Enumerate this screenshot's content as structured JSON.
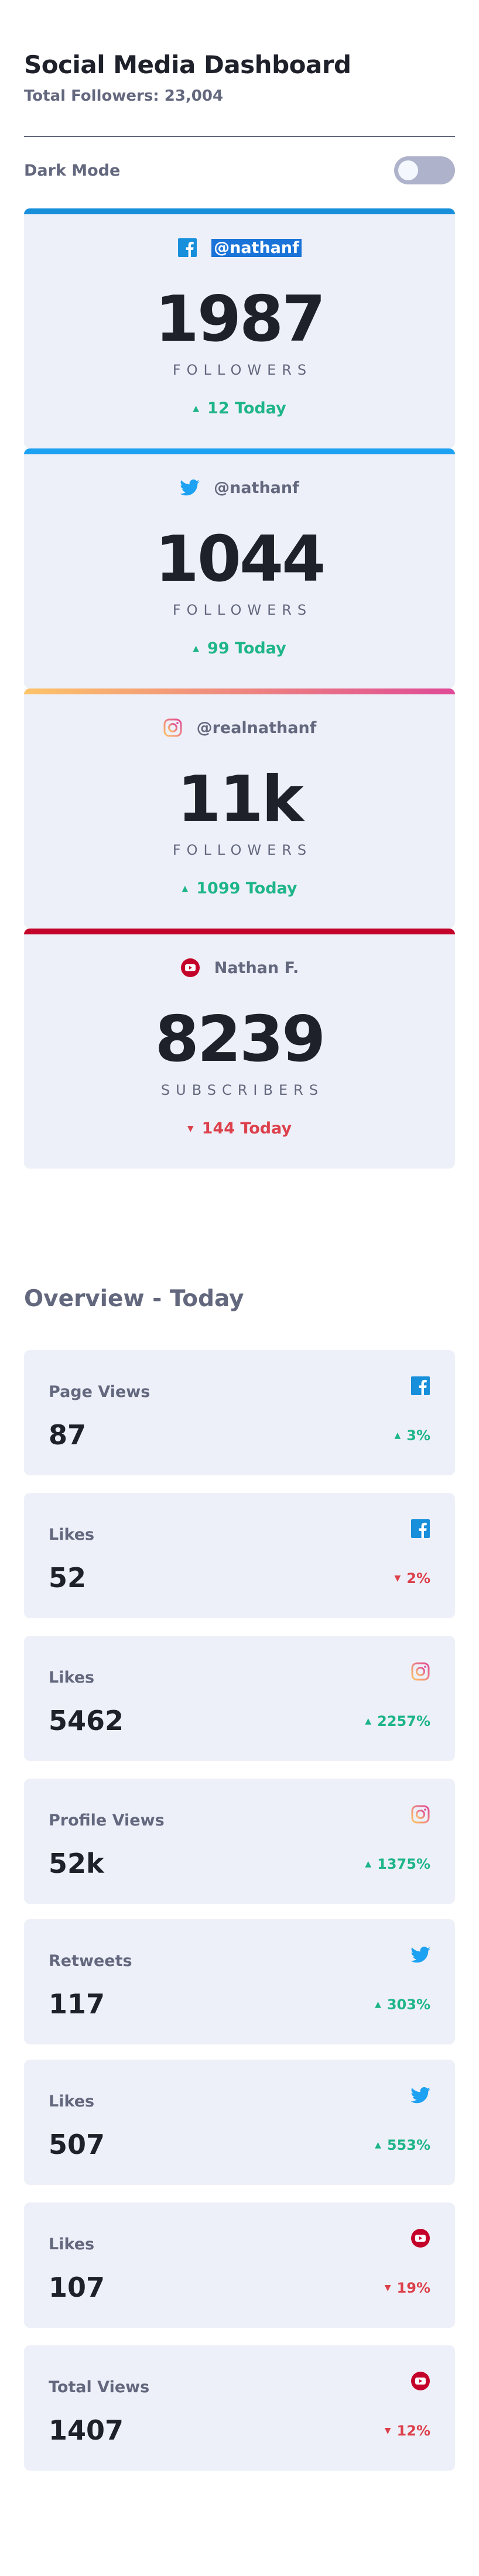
{
  "header": {
    "title": "Social Media Dashboard",
    "total_followers": "Total Followers: 23,004"
  },
  "dark_mode": {
    "label": "Dark Mode",
    "enabled": false
  },
  "follower_cards": [
    {
      "network": "facebook",
      "icon": "facebook-icon",
      "handle": "@nathanf",
      "count": "1987",
      "unit": "FOLLOWERS",
      "today": "12 Today",
      "trend": "up"
    },
    {
      "network": "twitter",
      "icon": "twitter-icon",
      "handle": "@nathanf",
      "count": "1044",
      "unit": "FOLLOWERS",
      "today": "99 Today",
      "trend": "up"
    },
    {
      "network": "instagram",
      "icon": "instagram-icon",
      "handle": "@realnathanf",
      "count": "11k",
      "unit": "FOLLOWERS",
      "today": "1099 Today",
      "trend": "up"
    },
    {
      "network": "youtube",
      "icon": "youtube-icon",
      "handle": "Nathan F.",
      "count": "8239",
      "unit": "SUBSCRIBERS",
      "today": "144 Today",
      "trend": "down"
    }
  ],
  "overview": {
    "title": "Overview - Today",
    "cards": [
      {
        "label": "Page Views",
        "icon": "facebook-icon",
        "value": "87",
        "change": "3%",
        "trend": "up"
      },
      {
        "label": "Likes",
        "icon": "facebook-icon",
        "value": "52",
        "change": "2%",
        "trend": "down"
      },
      {
        "label": "Likes",
        "icon": "instagram-icon",
        "value": "5462",
        "change": "2257%",
        "trend": "up"
      },
      {
        "label": "Profile Views",
        "icon": "instagram-icon",
        "value": "52k",
        "change": "1375%",
        "trend": "up"
      },
      {
        "label": "Retweets",
        "icon": "twitter-icon",
        "value": "117",
        "change": "303%",
        "trend": "up"
      },
      {
        "label": "Likes",
        "icon": "twitter-icon",
        "value": "507",
        "change": "553%",
        "trend": "up"
      },
      {
        "label": "Likes",
        "icon": "youtube-icon",
        "value": "107",
        "change": "19%",
        "trend": "down"
      },
      {
        "label": "Total Views",
        "icon": "youtube-icon",
        "value": "1407",
        "change": "12%",
        "trend": "down"
      }
    ]
  },
  "colors": {
    "up": "#1eb589",
    "down": "#dc414c",
    "facebook": "#178fdb",
    "twitter": "#1da1f2",
    "instagram_start": "#fdc468",
    "instagram_end": "#df4996",
    "youtube": "#c4032a",
    "card_bg": "#eef0f9"
  }
}
